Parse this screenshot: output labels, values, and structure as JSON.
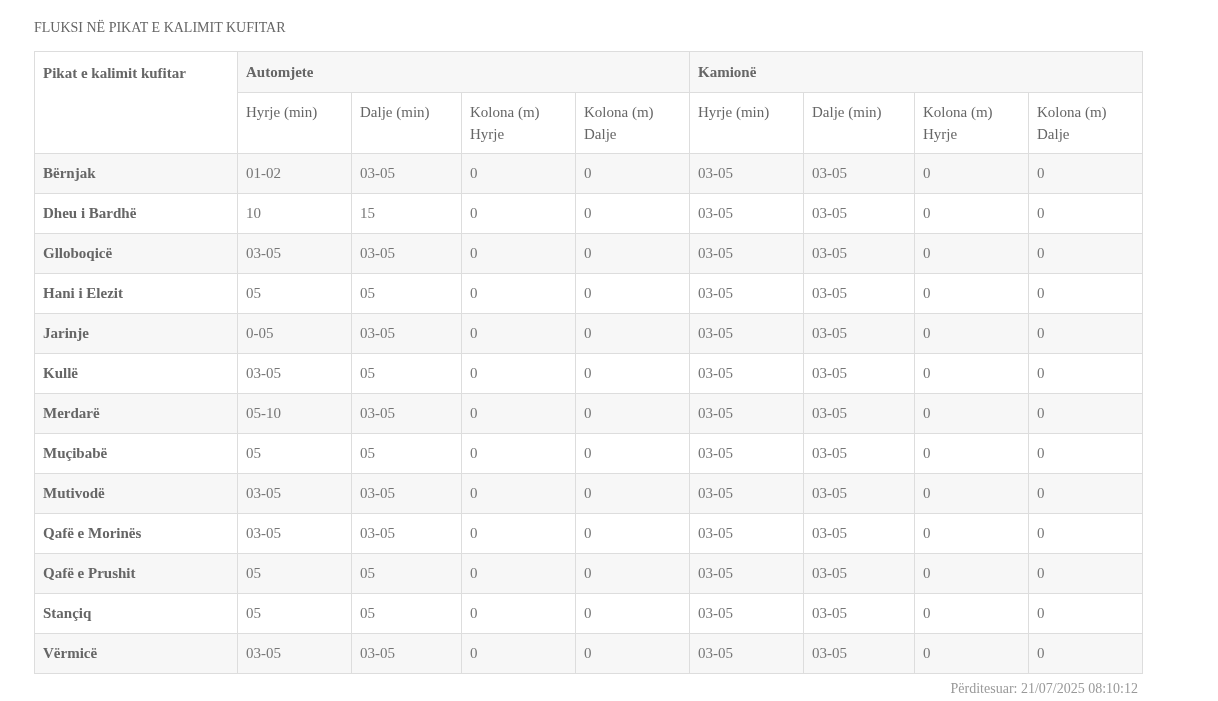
{
  "title": "FLUKSI NË PIKAT E KALIMIT KUFITAR",
  "table": {
    "corner_header": "Pikat e kalimit kufitar",
    "groups": [
      {
        "label": "Automjete",
        "columns": [
          "Hyrje (min)",
          "Dalje (min)",
          "Kolona (m) Hyrje",
          "Kolona (m) Dalje"
        ]
      },
      {
        "label": "Kamionë",
        "columns": [
          "Hyrje (min)",
          "Dalje (min)",
          "Kolona (m) Hyrje",
          "Kolona (m) Dalje"
        ]
      }
    ],
    "rows": [
      {
        "name": "Bërnjak",
        "cells": [
          "01-02",
          "03-05",
          "0",
          "0",
          "03-05",
          "03-05",
          "0",
          "0"
        ]
      },
      {
        "name": "Dheu i Bardhë",
        "cells": [
          "10",
          "15",
          "0",
          "0",
          "03-05",
          "03-05",
          "0",
          "0"
        ]
      },
      {
        "name": "Glloboqicë",
        "cells": [
          "03-05",
          "03-05",
          "0",
          "0",
          "03-05",
          "03-05",
          "0",
          "0"
        ]
      },
      {
        "name": "Hani i Elezit",
        "cells": [
          "05",
          "05",
          "0",
          "0",
          "03-05",
          "03-05",
          "0",
          "0"
        ]
      },
      {
        "name": "Jarinje",
        "cells": [
          "0-05",
          "03-05",
          "0",
          "0",
          "03-05",
          "03-05",
          "0",
          "0"
        ]
      },
      {
        "name": "Kullë",
        "cells": [
          "03-05",
          "05",
          "0",
          "0",
          "03-05",
          "03-05",
          "0",
          "0"
        ]
      },
      {
        "name": "Merdarë",
        "cells": [
          "05-10",
          "03-05",
          "0",
          "0",
          "03-05",
          "03-05",
          "0",
          "0"
        ]
      },
      {
        "name": "Muçibabë",
        "cells": [
          "05",
          "05",
          "0",
          "0",
          "03-05",
          "03-05",
          "0",
          "0"
        ]
      },
      {
        "name": "Mutivodë",
        "cells": [
          "03-05",
          "03-05",
          "0",
          "0",
          "03-05",
          "03-05",
          "0",
          "0"
        ]
      },
      {
        "name": "Qafë e Morinës",
        "cells": [
          "03-05",
          "03-05",
          "0",
          "0",
          "03-05",
          "03-05",
          "0",
          "0"
        ]
      },
      {
        "name": "Qafë e Prushit",
        "cells": [
          "05",
          "05",
          "0",
          "0",
          "03-05",
          "03-05",
          "0",
          "0"
        ]
      },
      {
        "name": "Stançiq",
        "cells": [
          "05",
          "05",
          "0",
          "0",
          "03-05",
          "03-05",
          "0",
          "0"
        ]
      },
      {
        "name": "Vërmicë",
        "cells": [
          "03-05",
          "03-05",
          "0",
          "0",
          "03-05",
          "03-05",
          "0",
          "0"
        ]
      }
    ]
  },
  "updated": "Përditesuar: 21/07/2025 08:10:12"
}
